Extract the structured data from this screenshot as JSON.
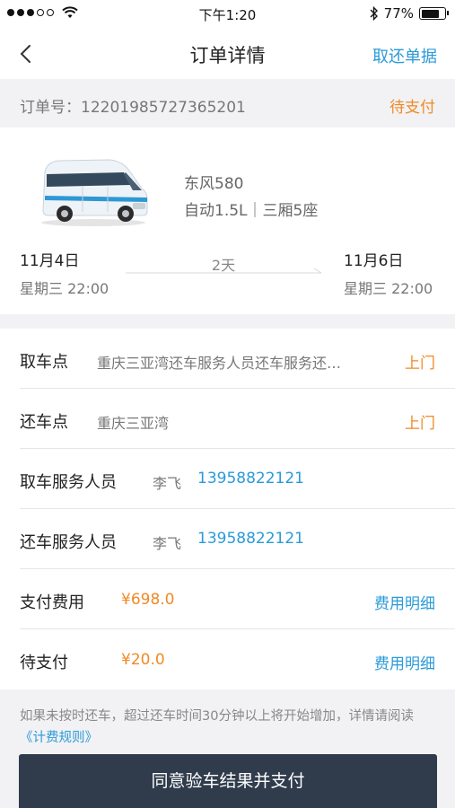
{
  "status_bar": {
    "time": "下午1:20",
    "battery_text": "77%",
    "battery_level": 0.77
  },
  "nav": {
    "title": "订单详情",
    "action": "取还单据"
  },
  "order": {
    "label": "订单号：",
    "number": "12201985727365201",
    "status": "待支付"
  },
  "car": {
    "name": "东风580",
    "spec": "自动1.5L｜三厢5座"
  },
  "trip": {
    "start_date": "11月4日",
    "start_time": "星期三 22:00",
    "duration": "2天",
    "end_date": "11月6日",
    "end_time": "星期三 22:00"
  },
  "rows": {
    "pickup": {
      "label": "取车点",
      "value": "重庆三亚湾还车服务人员还车服务还…",
      "action": "上门"
    },
    "return": {
      "label": "还车点",
      "value": "重庆三亚湾",
      "action": "上门"
    },
    "pickup_staff": {
      "label": "取车服务人员",
      "name": "李飞",
      "phone": "13958822121"
    },
    "return_staff": {
      "label": "还车服务人员",
      "name": "李飞",
      "phone": "13958822121"
    },
    "paid": {
      "label": "支付费用",
      "amount": "¥698.0",
      "action": "费用明细"
    },
    "pending": {
      "label": "待支付",
      "amount": "¥20.0",
      "action": "费用明细"
    }
  },
  "notice": {
    "text": "如果未按时还车，超过还车时间30分钟以上将开始增加，详情请阅读",
    "link": "《计费规则》"
  },
  "button": {
    "label": "同意验车结果并支付"
  },
  "colors": {
    "accent_blue": "#2a9bd8",
    "accent_orange": "#f08a24",
    "button_dark": "#303c4c"
  }
}
